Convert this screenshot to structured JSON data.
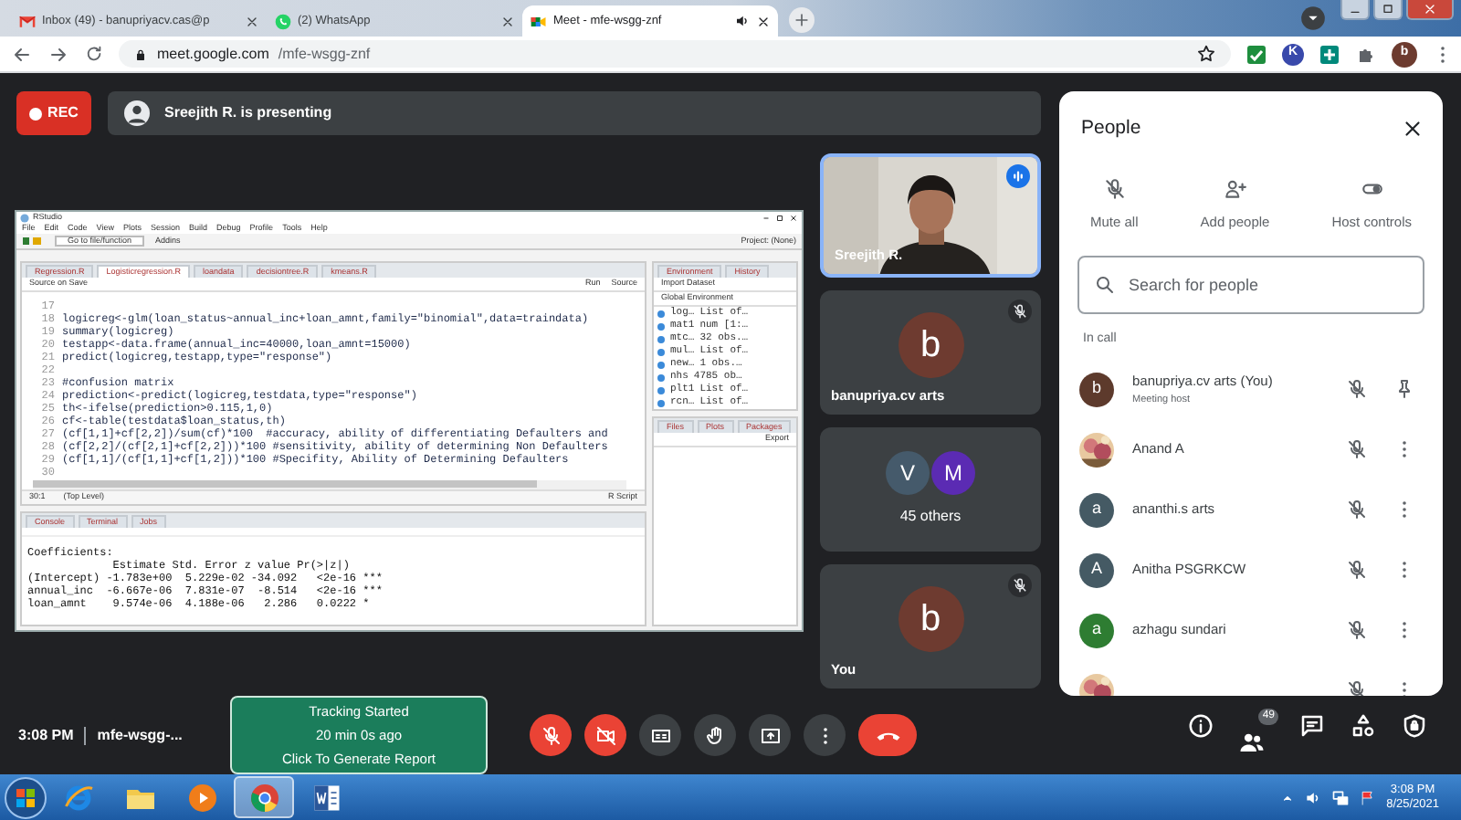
{
  "browser": {
    "tabs": [
      {
        "title": "Inbox (49) - banupriyacv.cas@p",
        "kind": "mail",
        "selected": false,
        "audio": false
      },
      {
        "title": "(2) WhatsApp",
        "kind": "chat",
        "selected": false,
        "audio": false
      },
      {
        "title": "Meet - mfe-wsgg-znf",
        "kind": "meet",
        "selected": true,
        "audio": true
      }
    ],
    "address": {
      "host": "meet.google.com",
      "path": "/mfe-wsgg-znf"
    },
    "extensions": [
      {
        "kind": "check"
      },
      {
        "kind": "letter",
        "letter": "K"
      },
      {
        "kind": "plus"
      },
      {
        "kind": "puzzle"
      }
    ],
    "profile": "b"
  },
  "meet": {
    "rec": "REC",
    "presenter_banner": "Sreejith R. is presenting",
    "presentation": {
      "app_title": "RStudio",
      "menu": [
        "File",
        "Edit",
        "Code",
        "View",
        "Plots",
        "Session",
        "Build",
        "Debug",
        "Profile",
        "Tools",
        "Help"
      ],
      "goto": "Go to file/function",
      "addins": "Addins",
      "project": "Project: (None)",
      "editor_tabs": [
        {
          "label": "Regression.R",
          "selected": false
        },
        {
          "label": "Logisticregression.R",
          "selected": true
        },
        {
          "label": "loandata",
          "selected": false
        },
        {
          "label": "decisiontree.R",
          "selected": false
        },
        {
          "label": "kmeans.R",
          "selected": false
        }
      ],
      "source_on_save": "Source on Save",
      "run": "Run",
      "source": "Source",
      "code": [
        {
          "n": "17"
        },
        {
          "n": "18",
          "text": "logicreg<-glm(loan_status~annual_inc+loan_amnt,family=\"binomial\",data=traindata)"
        },
        {
          "n": "19",
          "text": "summary(logicreg)"
        },
        {
          "n": "20",
          "text": "testapp<-data.frame(annual_inc=40000,loan_amnt=15000)"
        },
        {
          "n": "21",
          "text": "predict(logicreg,testapp,type=\"response\")"
        },
        {
          "n": "22"
        },
        {
          "n": "23",
          "text": "#confusion matrix"
        },
        {
          "n": "24",
          "text": "prediction<-predict(logicreg,testdata,type=\"response\")"
        },
        {
          "n": "25",
          "text": "th<-ifelse(prediction>0.115,1,0)"
        },
        {
          "n": "26",
          "text": "cf<-table(testdata$loan_status,th)"
        },
        {
          "n": "27",
          "text": "(cf[1,1]+cf[2,2])/sum(cf)*100  #accuracy, ability of differentiating Defaulters and"
        },
        {
          "n": "28",
          "text": "(cf[2,2]/(cf[2,1]+cf[2,2]))*100 #sensitivity, ability of determining Non Defaulters"
        },
        {
          "n": "29",
          "text": "(cf[1,1]/(cf[1,1]+cf[1,2]))*100 #Specifity, Ability of Determining Defaulters"
        },
        {
          "n": "30"
        }
      ],
      "status": {
        "position": "30:1",
        "scope": "(Top Level)",
        "type": "R Script"
      },
      "console_tabs": [
        "Console",
        "Terminal",
        "Jobs"
      ],
      "console": [
        "Coefficients:",
        "             Estimate Std. Error z value Pr(>|z|)",
        "(Intercept) -1.783e+00  5.229e-02 -34.092   <2e-16 ***",
        "annual_inc  -6.667e-06  7.831e-07  -8.514   <2e-16 ***",
        "loan_amnt    9.574e-06  4.188e-06   2.286   0.0222 *"
      ],
      "env_tabs": [
        "Environment",
        "History"
      ],
      "import": "Import Dataset",
      "global_env": "Global Environment",
      "env_items": [
        {
          "name": "log…",
          "value": "List of…"
        },
        {
          "name": "mat1",
          "value": "num [1:…"
        },
        {
          "name": "mtc…",
          "value": "32 obs.…"
        },
        {
          "name": "mul…",
          "value": "List of…"
        },
        {
          "name": "new…",
          "value": "1 obs.…"
        },
        {
          "name": "nhs",
          "value": "4785 ob…"
        },
        {
          "name": "plt1",
          "value": "List of…"
        },
        {
          "name": "rcn…",
          "value": "List of…"
        }
      ],
      "files_tabs": [
        "Files",
        "Plots",
        "Packages"
      ],
      "export": "Export"
    },
    "tiles": [
      {
        "kind": "video",
        "name": "Sreejith R.",
        "speaking": true
      },
      {
        "kind": "avatar",
        "letter": "b",
        "color": "#6e3b30",
        "name": "banupriya.cv arts",
        "muted": true
      },
      {
        "kind": "group",
        "avatars": [
          {
            "letter": "V",
            "color": "#455a6b"
          },
          {
            "letter": "M",
            "color": "#5b2bb3"
          }
        ],
        "label": "45 others"
      },
      {
        "kind": "avatar",
        "letter": "b",
        "color": "#6e3b30",
        "name": "You",
        "muted": true
      }
    ],
    "people": {
      "title": "People",
      "actions": [
        {
          "kind": "mute",
          "label": "Mute all"
        },
        {
          "kind": "add",
          "label": "Add people"
        },
        {
          "kind": "host",
          "label": "Host controls"
        }
      ],
      "search": {
        "placeholder": "Search for people"
      },
      "section": "In call",
      "participants": [
        {
          "name": "banupriya.cv arts (You)",
          "subtitle": "Meeting host",
          "avatar": {
            "kind": "letter",
            "letter": "b",
            "color": "#5d3a2c"
          },
          "muted": true,
          "action": {
            "kind": "pin"
          }
        },
        {
          "name": "Anand A",
          "muted": true,
          "action": {
            "kind": "more"
          }
        },
        {
          "name": "ananthi.s arts",
          "avatar": {
            "kind": "letter",
            "letter": "a",
            "color": "#455a64"
          },
          "muted": true,
          "action": {
            "kind": "more"
          }
        },
        {
          "name": "Anitha PSGRKCW",
          "avatar": {
            "kind": "letter",
            "letter": "A",
            "color": "#455a64"
          },
          "muted": true,
          "action": {
            "kind": "more"
          }
        },
        {
          "name": "azhagu sundari",
          "avatar": {
            "kind": "letter",
            "letter": "a",
            "color": "#2e7d32"
          },
          "muted": true,
          "action": {
            "kind": "more"
          }
        },
        {
          "muted": true,
          "action": {
            "kind": "more"
          }
        }
      ]
    },
    "bottom": {
      "time": "3:08 PM",
      "meeting_code": "mfe-wsgg-...",
      "tracking": [
        "Tracking Started",
        "20 min 0s ago",
        "Click To Generate Report"
      ],
      "controls": [
        {
          "kind": "mic",
          "off": true
        },
        {
          "kind": "camera",
          "off": true
        },
        {
          "kind": "captions",
          "off": false
        },
        {
          "kind": "hand",
          "off": false
        },
        {
          "kind": "present",
          "off": false
        },
        {
          "kind": "more",
          "off": false
        },
        {
          "kind": "end"
        }
      ],
      "side": [
        {
          "kind": "info"
        },
        {
          "kind": "people",
          "badge": "49"
        },
        {
          "kind": "chat"
        },
        {
          "kind": "activities"
        },
        {
          "kind": "safety"
        }
      ]
    }
  },
  "taskbar": {
    "apps": [
      {
        "kind": "ie",
        "selected": false
      },
      {
        "kind": "folder",
        "selected": false
      },
      {
        "kind": "media",
        "selected": false
      },
      {
        "kind": "chrome",
        "selected": true
      },
      {
        "kind": "word",
        "selected": false
      }
    ],
    "time": "3:08 PM",
    "date": "8/25/2021"
  }
}
